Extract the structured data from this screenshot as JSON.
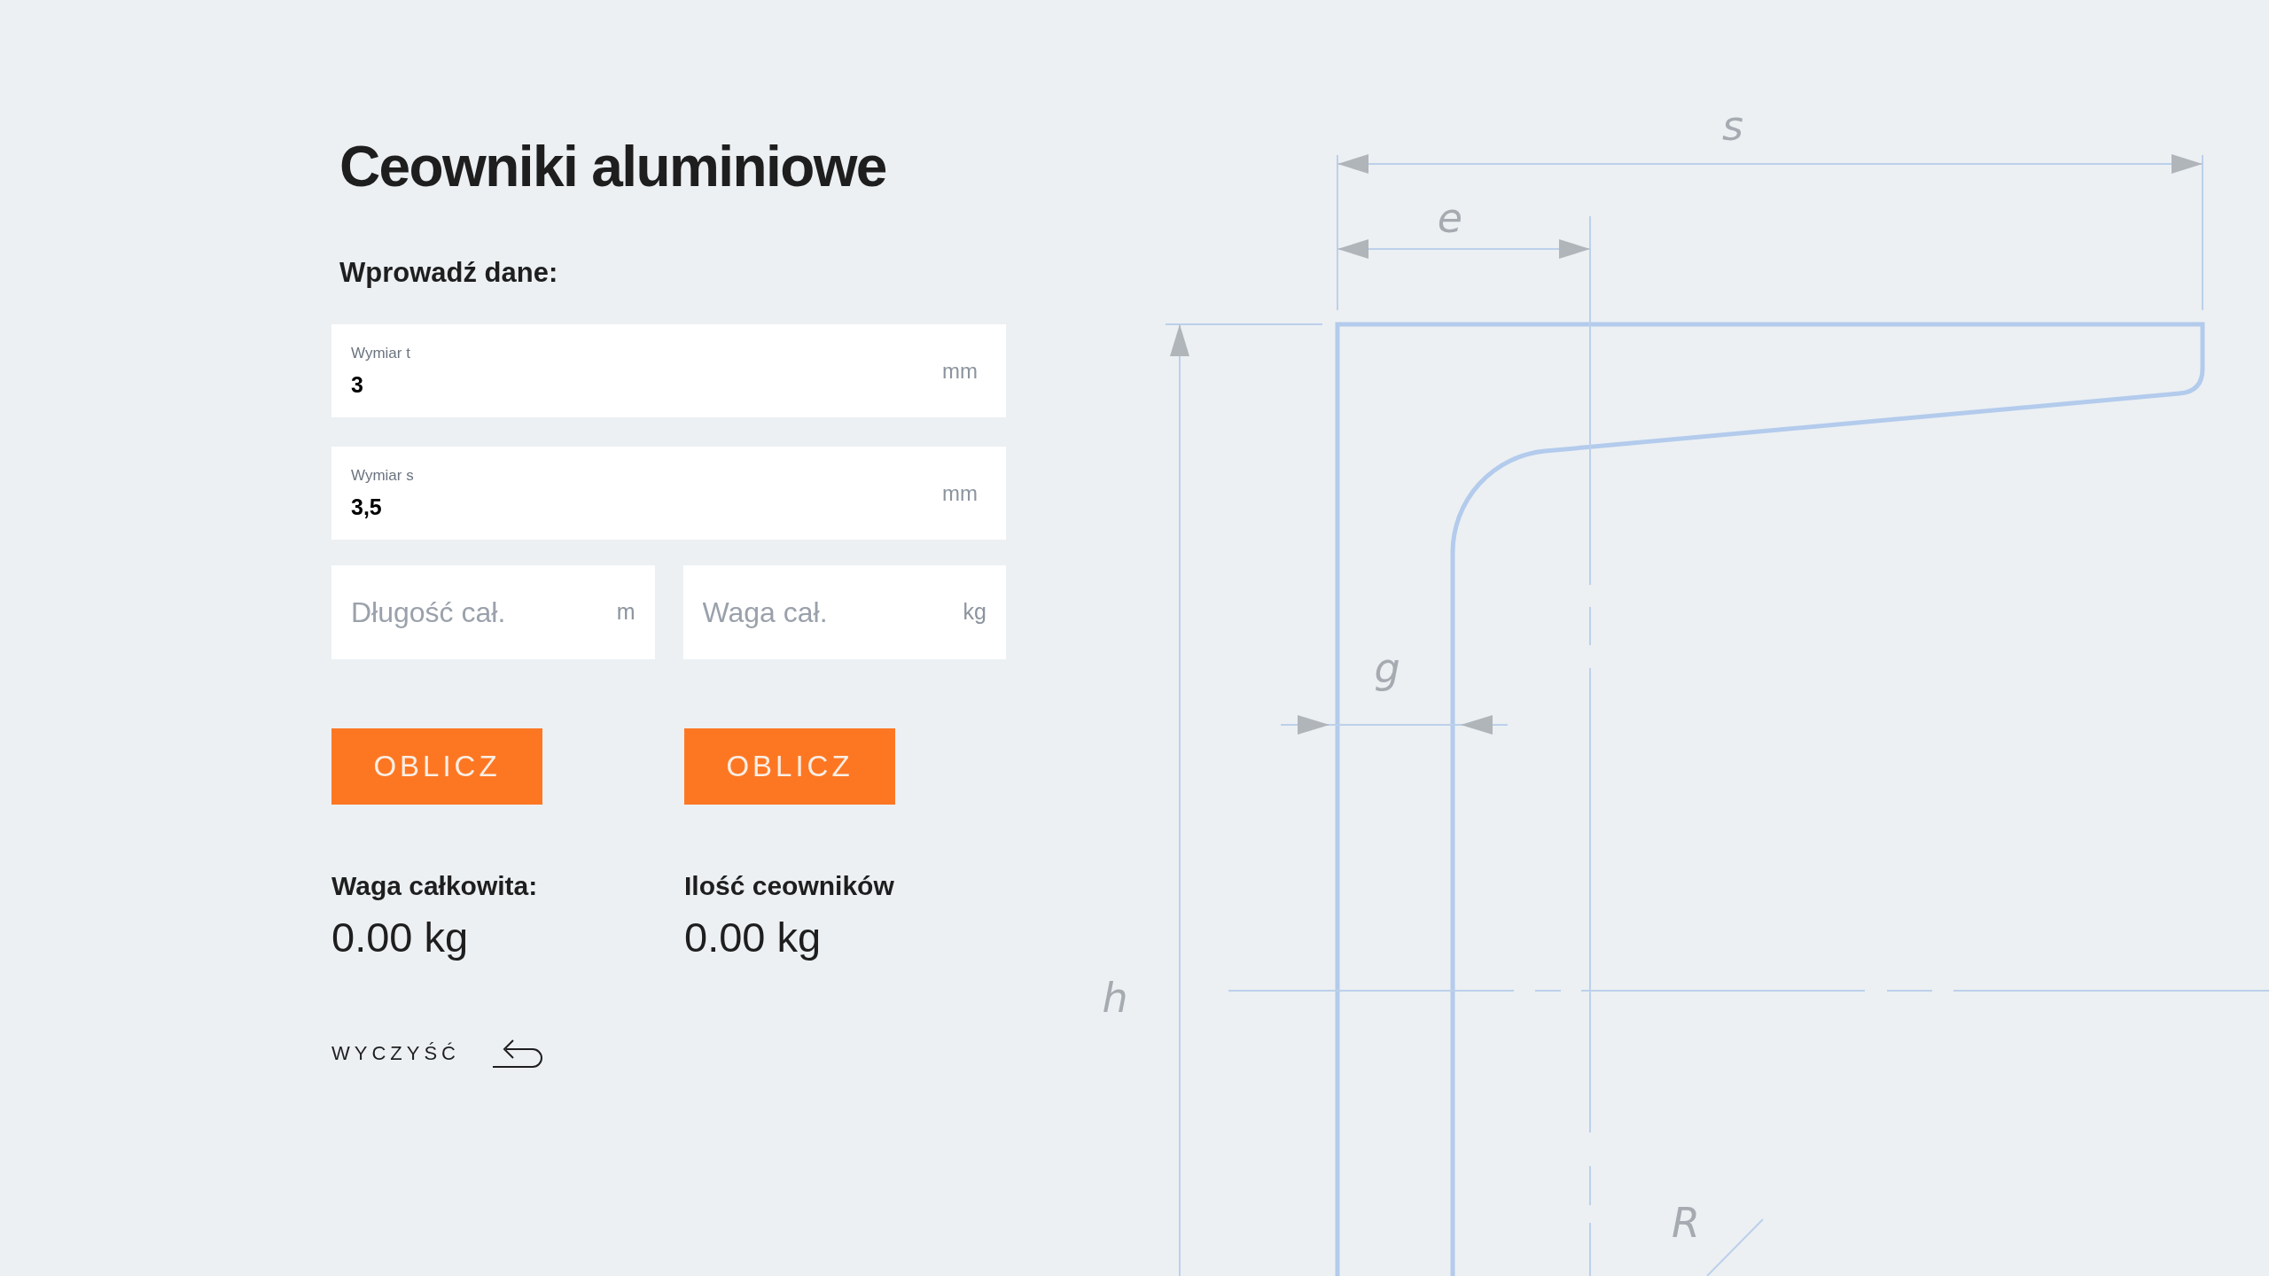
{
  "title": "Ceowniki aluminiowe",
  "section_label": "Wprowadź dane:",
  "fields": [
    {
      "label": "Wymiar t",
      "value": "3",
      "unit": "mm"
    },
    {
      "label": "Wymiar s",
      "value": "3,5",
      "unit": "mm"
    }
  ],
  "split_fields": [
    {
      "placeholder": "Długość cał.",
      "unit": "m"
    },
    {
      "placeholder": "Waga cał.",
      "unit": "kg"
    }
  ],
  "columns": [
    {
      "button": "OBLICZ",
      "result_label": "Waga całkowita:",
      "result_value": "0.00 kg"
    },
    {
      "button": "OBLICZ",
      "result_label": "Ilość ceowników",
      "result_value": "0.00 kg"
    }
  ],
  "clear_label": "WYCZYŚĆ",
  "diagram_labels": [
    {
      "kind": "s",
      "text": "s"
    },
    {
      "kind": "e",
      "text": "e"
    },
    {
      "kind": "g",
      "text": "g"
    },
    {
      "kind": "h",
      "text": "h"
    },
    {
      "kind": "r",
      "text": "R"
    }
  ]
}
